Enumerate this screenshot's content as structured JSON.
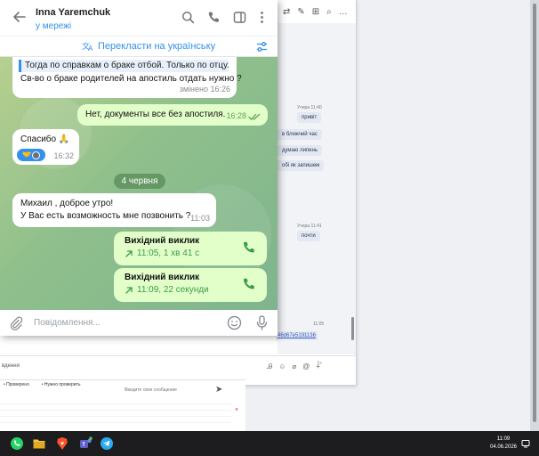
{
  "telegram": {
    "contact_name": "Inna Yaremchuk",
    "contact_status": "у мережі",
    "translate_label": "Перекласти на українську",
    "messages": [
      {
        "direction": "in",
        "quote": "Тогда по справкам о браке отбой. Только по отцу.",
        "text": "Св-во о браке родителей на апостиль отдать нужно ?",
        "time": "змінено 16:26"
      },
      {
        "direction": "out",
        "text": "Нет, документы все без апостиля.",
        "time": "16:28"
      },
      {
        "direction": "in",
        "text": "Спасибо 🙏",
        "time": "16:32"
      }
    ],
    "date_separator": "4 червня",
    "messages_after": [
      {
        "direction": "in",
        "line1": "Михаил , доброе утро!",
        "line2": "У Вас есть возможность мне позвонить ?",
        "time": "11:03"
      }
    ],
    "calls": [
      {
        "title": "Вихідний виклик",
        "details": "11:05, 1 хв 41 с"
      },
      {
        "title": "Вихідний виклик",
        "details": "11:09, 22 секунди"
      }
    ],
    "composer_placeholder": "Повідомлення..."
  },
  "background_chat": {
    "messages": [
      {
        "text": "привіт",
        "time": "Учора 11:40"
      },
      {
        "text": "в ближчий час"
      },
      {
        "text": "думаю липень"
      },
      {
        "text": "обі як запишем"
      },
      {
        "text": "почти",
        "time": "Учора 11:41"
      }
    ],
    "link_time": "11:05",
    "link_text": "46d67e5191136",
    "input_label": "вдення"
  },
  "background_window2": {
    "tabs": [
      "• Проверено",
      "• Нужно проверить"
    ],
    "hint": "Введите свое сообщение"
  },
  "taskbar": {
    "apps": [
      "whatsapp-icon",
      "file-explorer-icon",
      "brave-icon",
      "teams-icon",
      "telegram-icon"
    ],
    "time": "11:09",
    "date": "04.06.2026"
  },
  "colors": {
    "accent": "#3390ec",
    "outgoing_bubble": "#e2fec9",
    "incoming_bubble": "#ffffff",
    "call_green": "#3d9b4a"
  }
}
